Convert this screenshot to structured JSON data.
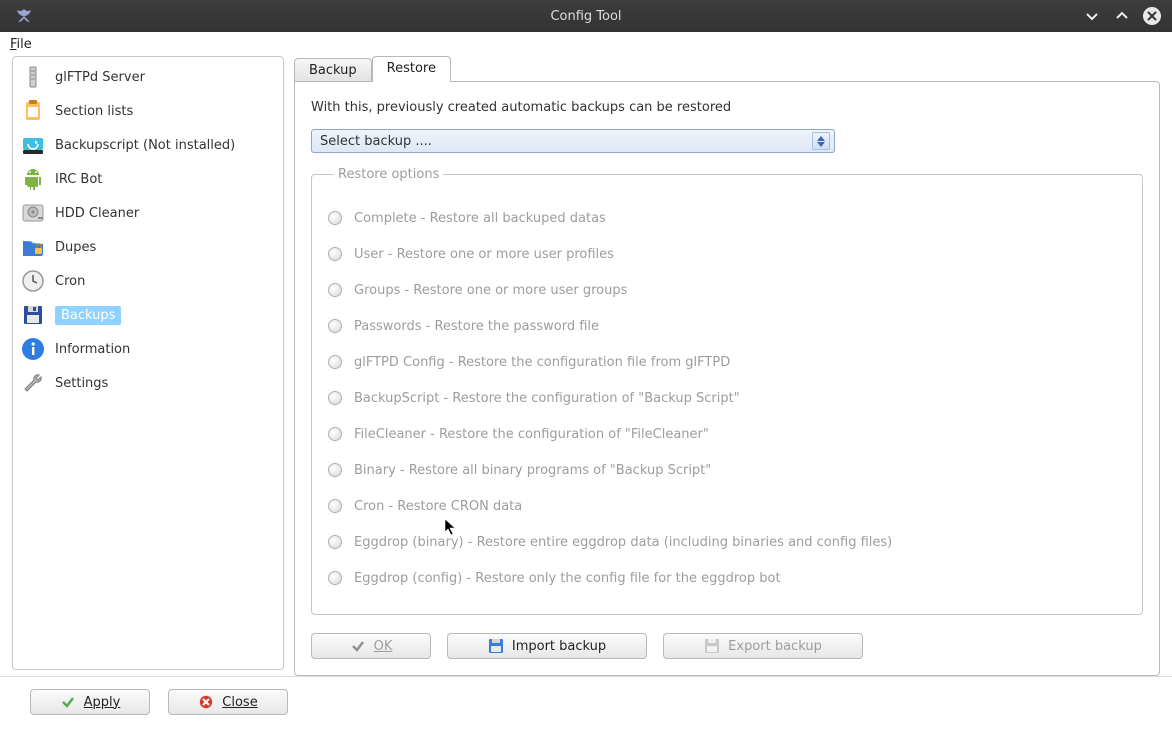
{
  "window": {
    "title": "Config Tool",
    "app_icon": "butterfly-icon"
  },
  "menubar": {
    "file": "File"
  },
  "sidebar": {
    "items": [
      {
        "label": "glFTPd Server",
        "icon": "server-rack-icon"
      },
      {
        "label": "Section lists",
        "icon": "clipboard-icon"
      },
      {
        "label": "Backupscript (Not installed)",
        "icon": "drive-loop-icon"
      },
      {
        "label": "IRC Bot",
        "icon": "android-icon"
      },
      {
        "label": "HDD Cleaner",
        "icon": "hdd-icon"
      },
      {
        "label": "Dupes",
        "icon": "folder-lock-icon"
      },
      {
        "label": "Cron",
        "icon": "clock-icon"
      },
      {
        "label": "Backups",
        "icon": "floppy-icon",
        "selected": true
      },
      {
        "label": "Information",
        "icon": "info-icon"
      },
      {
        "label": "Settings",
        "icon": "wrench-icon"
      }
    ]
  },
  "tabs": {
    "backup": "Backup",
    "restore": "Restore",
    "active": "restore"
  },
  "restore": {
    "description": "With this, previously created automatic backups can be restored",
    "select_placeholder": "Select backup ....",
    "legend": "Restore options",
    "options": [
      "Complete - Restore all backuped datas",
      "User - Restore one or more user profiles",
      "Groups - Restore one or more user groups",
      "Passwords - Restore the password file",
      "glFTPD Config - Restore the configuration file from glFTPD",
      "BackupScript - Restore the configuration of \"Backup Script\"",
      "FileCleaner - Restore the configuration of \"FileCleaner\"",
      "Binary - Restore all binary programs of \"Backup Script\"",
      "Cron - Restore CRON data",
      "Eggdrop (binary) - Restore  entire eggdrop data (including binaries and config files)",
      "Eggdrop (config) - Restore only the config file for the eggdrop bot"
    ],
    "buttons": {
      "ok": "OK",
      "import": "Import backup",
      "export": "Export backup"
    }
  },
  "footer": {
    "apply": "Apply",
    "close": "Close"
  }
}
